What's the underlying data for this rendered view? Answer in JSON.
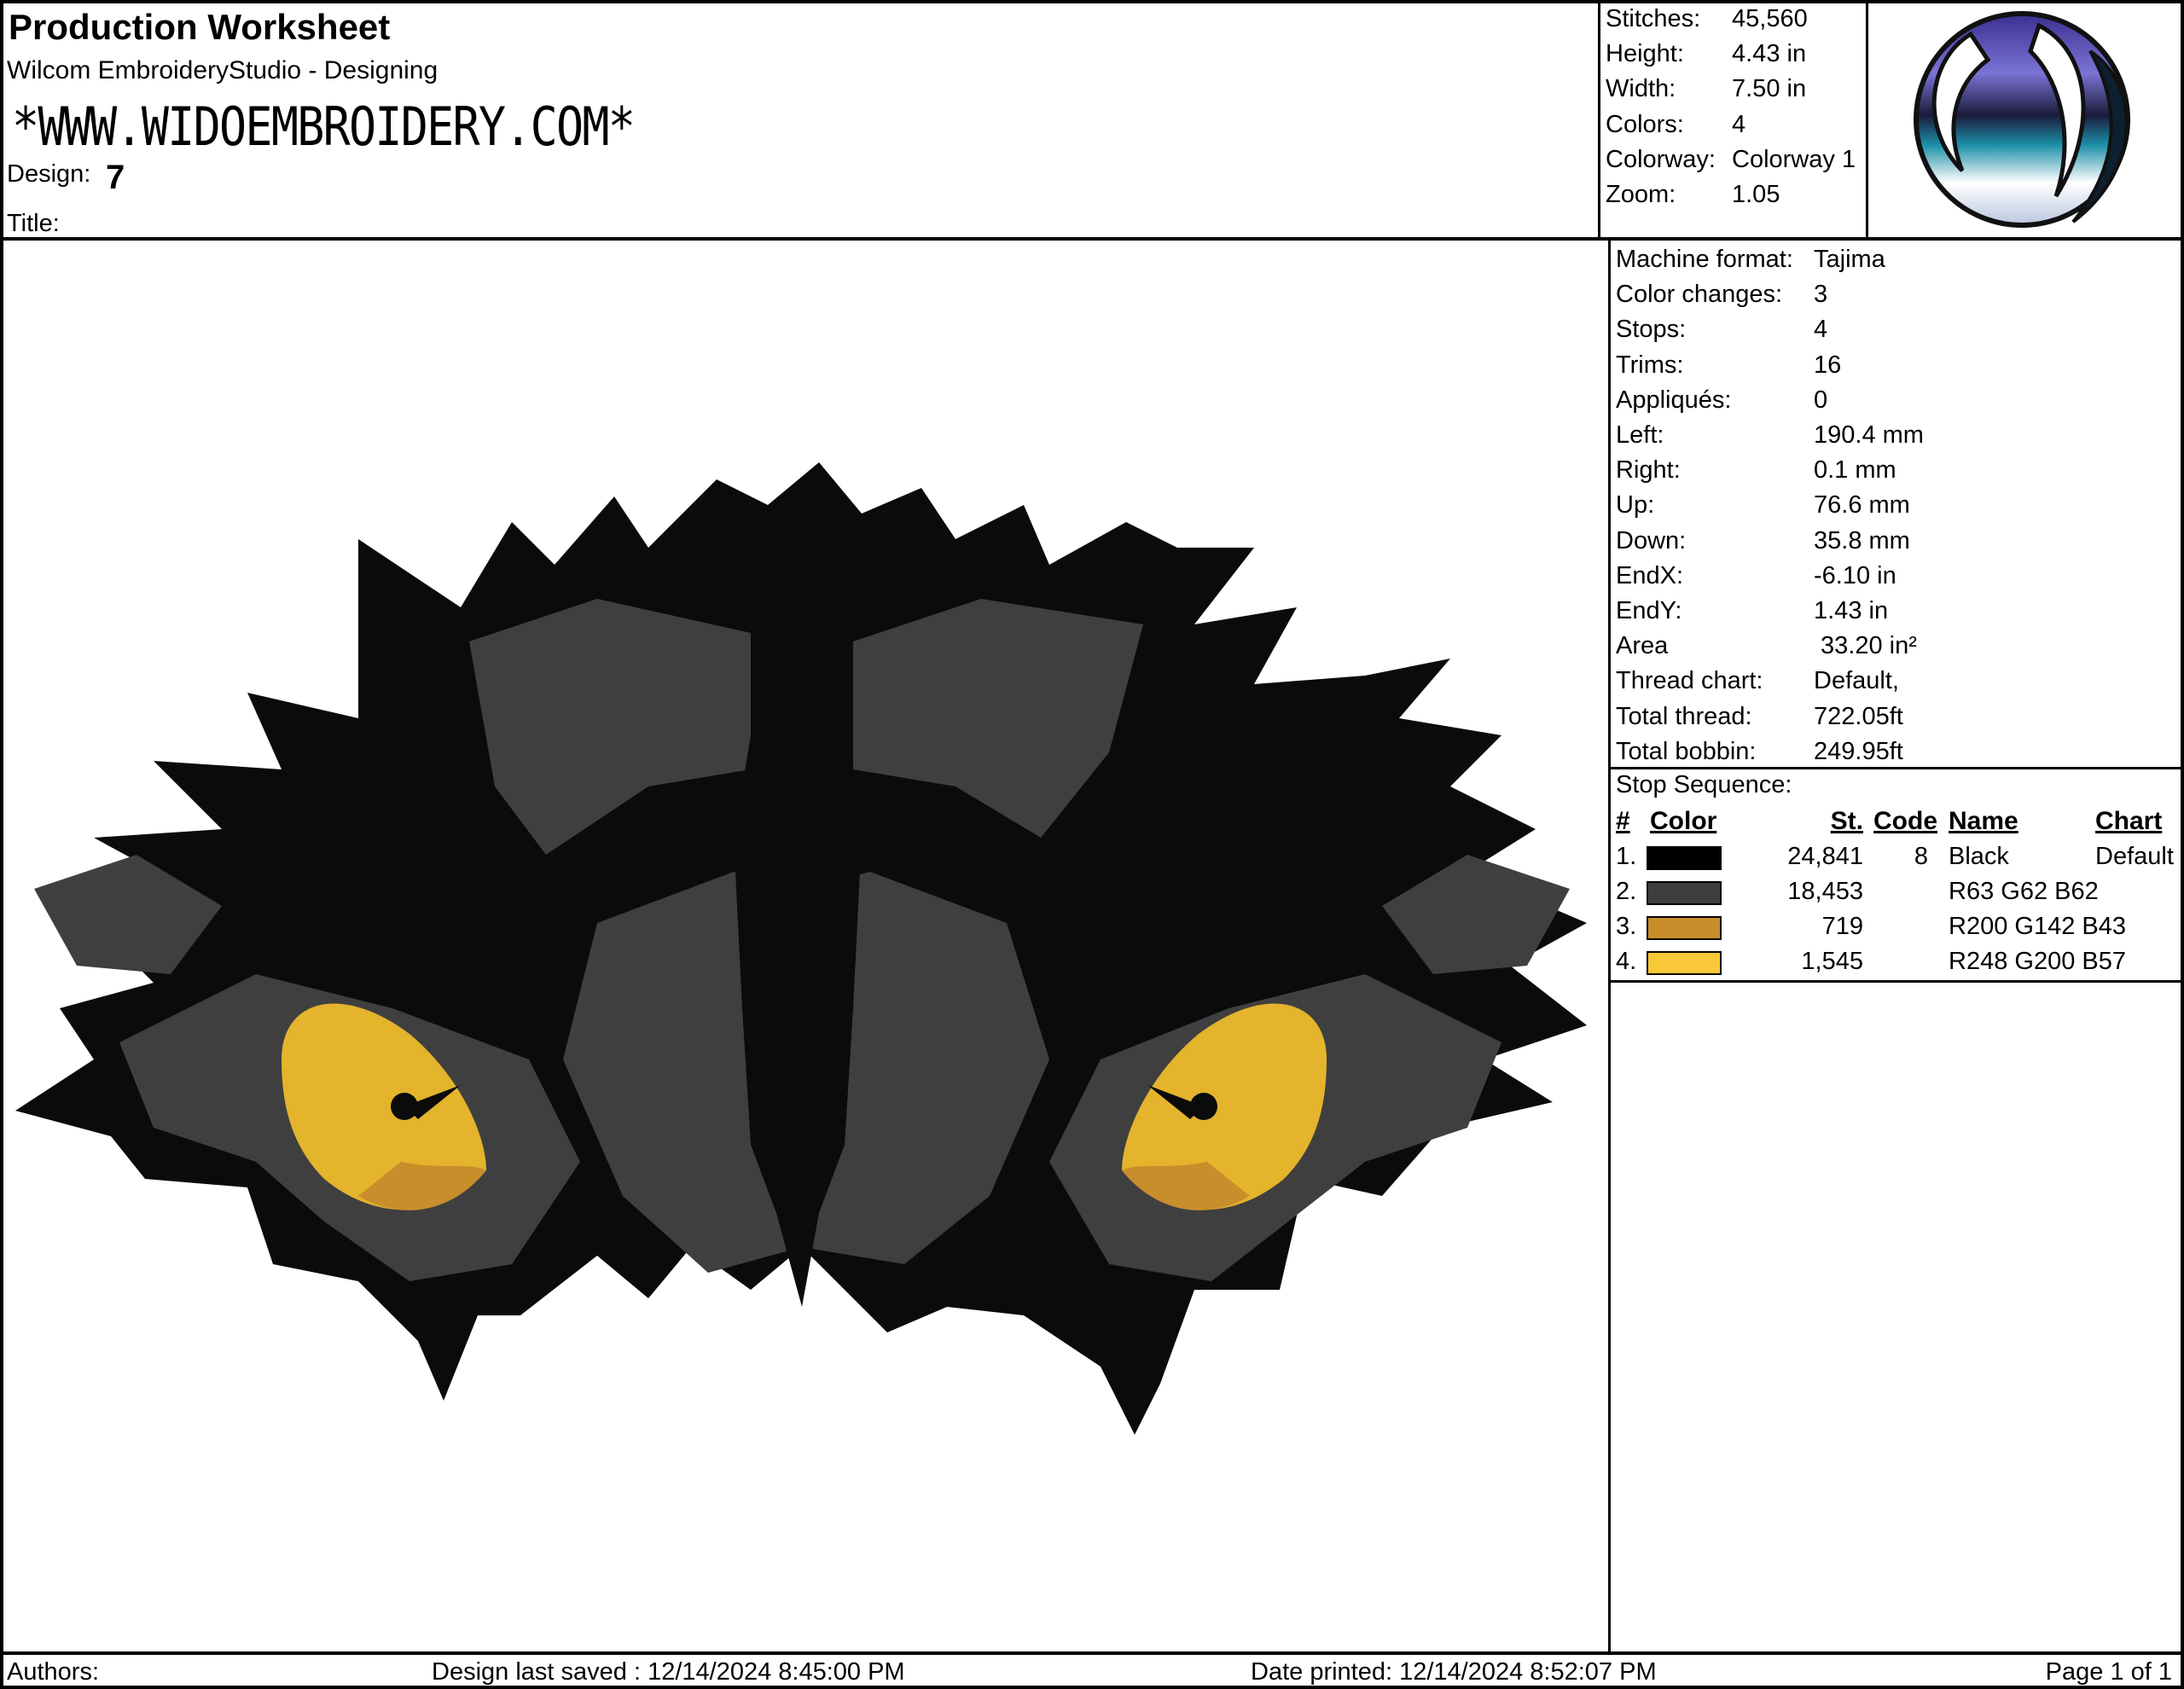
{
  "header": {
    "title": "Production Worksheet",
    "software": "Wilcom EmbroideryStudio - Designing",
    "website": "*WWW.WIDOEMBROIDERY.COM*",
    "design_label": "Design:",
    "design_value": "7",
    "title_label": "Title:"
  },
  "stats": [
    {
      "key": "Stitches:",
      "value": "45,560"
    },
    {
      "key": "Height:",
      "value": "4.43 in"
    },
    {
      "key": "Width:",
      "value": "7.50 in"
    },
    {
      "key": "Colors:",
      "value": "4"
    },
    {
      "key": "Colorway:",
      "value": "Colorway 1"
    },
    {
      "key": "Zoom:",
      "value": "1.05"
    }
  ],
  "details": [
    {
      "key": "Machine format:",
      "value": "Tajima"
    },
    {
      "key": "Color changes:",
      "value": "3"
    },
    {
      "key": "Stops:",
      "value": "4"
    },
    {
      "key": "Trims:",
      "value": "16"
    },
    {
      "key": "Appliqués:",
      "value": "0"
    },
    {
      "key": "Left:",
      "value": "190.4 mm"
    },
    {
      "key": "Right:",
      "value": "0.1 mm"
    },
    {
      "key": "Up:",
      "value": "76.6 mm"
    },
    {
      "key": "Down:",
      "value": "35.8 mm"
    },
    {
      "key": "EndX:",
      "value": "-6.10 in"
    },
    {
      "key": "EndY:",
      "value": "1.43 in"
    },
    {
      "key": "Area",
      "value": " 33.20 in²"
    },
    {
      "key": "Thread chart:",
      "value": "Default,"
    },
    {
      "key": "Total thread:",
      "value": "722.05ft"
    },
    {
      "key": "Total bobbin:",
      "value": "249.95ft"
    }
  ],
  "stop_sequence": {
    "label": "Stop Sequence:",
    "headers": {
      "num": "#",
      "color": "Color",
      "st": "St.",
      "code": "Code",
      "name": "Name",
      "chart": "Chart"
    },
    "rows": [
      {
        "num": "1.",
        "swatch": "#000000",
        "st": "24,841",
        "code": "8",
        "name": "Black",
        "chart": "Default"
      },
      {
        "num": "2.",
        "swatch": "#3f3e3e",
        "st": "18,453",
        "code": "",
        "name": "R63 G62 B62",
        "chart": ""
      },
      {
        "num": "3.",
        "swatch": "#c88e2b",
        "st": "719",
        "code": "",
        "name": "R200 G142 B43",
        "chart": ""
      },
      {
        "num": "4.",
        "swatch": "#f8c839",
        "st": "1,545",
        "code": "",
        "name": "R248 G200 B57",
        "chart": ""
      }
    ]
  },
  "footer": {
    "authors": "Authors:",
    "saved": "Design last saved : 12/14/2024 8:45:00 PM",
    "printed": "Date printed: 12/14/2024 8:52:07 PM",
    "page": "Page 1 of 1"
  },
  "colors": {
    "fur_dark": "#0b0b0b",
    "fur_grey": "#403f3f",
    "eye_yellow": "#e3b42c",
    "eye_orange": "#c88e2b"
  }
}
